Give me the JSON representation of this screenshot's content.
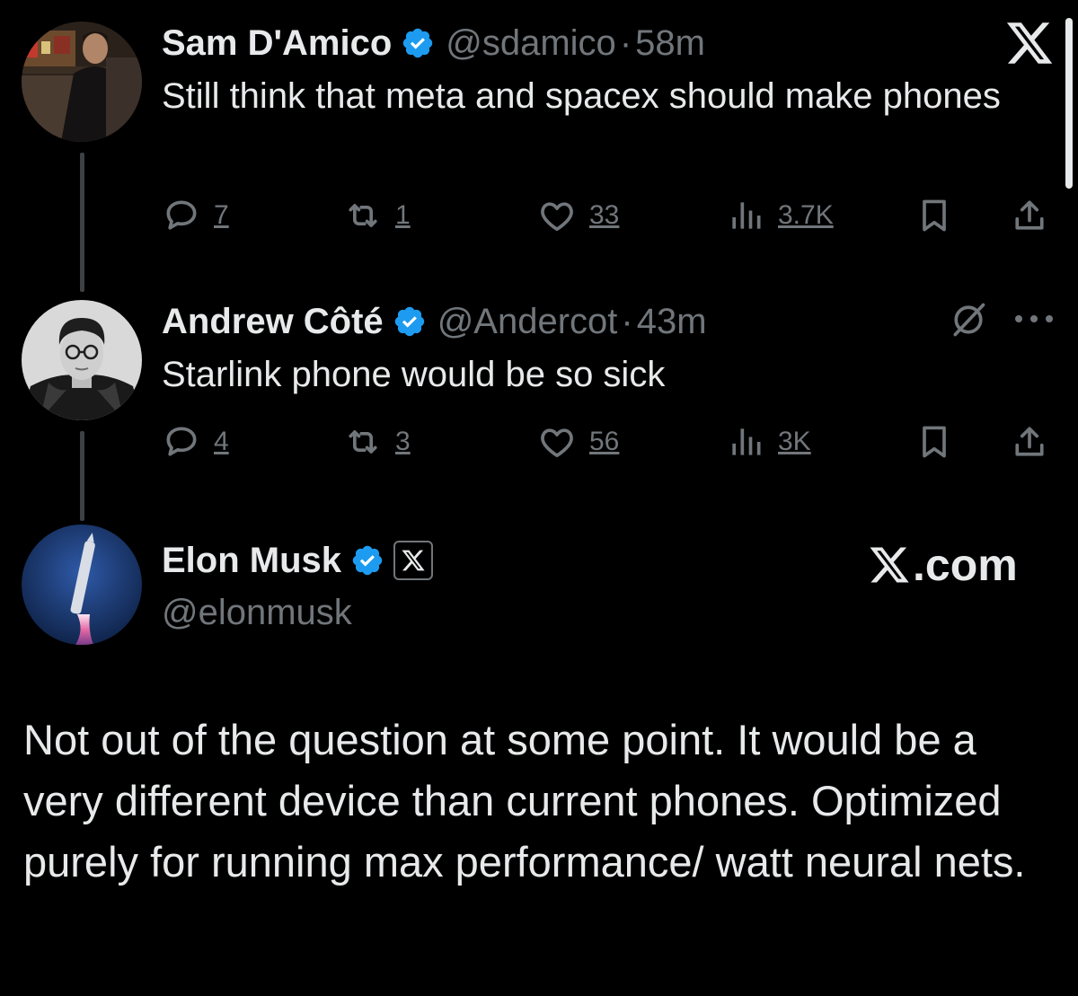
{
  "app": {
    "brand": "X",
    "accent_color": "#1d9bf0",
    "background": "#000000"
  },
  "tweets": [
    {
      "author": "Sam D'Amico",
      "handle": "@sdamico",
      "separator": "·",
      "time": "58m",
      "verified": true,
      "text": "Still think that meta and spacex should make phones",
      "stats": {
        "replies": "7",
        "reposts": "1",
        "likes": "33",
        "views": "3.7K"
      }
    },
    {
      "author": "Andrew Côté",
      "handle": "@Andercot",
      "separator": "·",
      "time": "43m",
      "verified": true,
      "text": "Starlink phone would be so sick",
      "stats": {
        "replies": "4",
        "reposts": "3",
        "likes": "56",
        "views": "3K"
      }
    }
  ],
  "main_tweet": {
    "author": "Elon Musk",
    "handle": "@elonmusk",
    "verified": true,
    "affiliation": "X",
    "site_label": ".com",
    "text": "Not out of the question at some point. It would be a very different device than current phones. Optimized purely for running max performance/ watt neural nets."
  },
  "icons": {
    "top_right": "x-logo-icon",
    "actions": [
      "reply-icon",
      "repost-icon",
      "like-icon",
      "views-icon",
      "bookmark-icon",
      "share-icon"
    ],
    "tweet_menu": [
      "grok-icon",
      "more-icon"
    ]
  }
}
